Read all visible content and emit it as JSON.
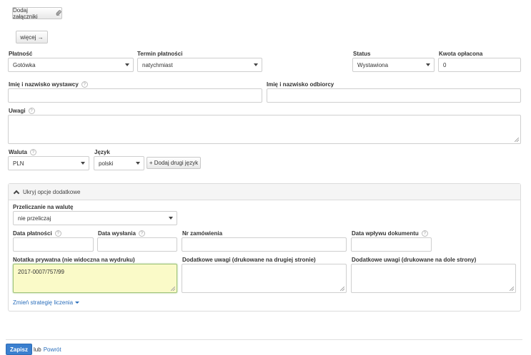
{
  "attachments": {
    "label": "Dodaj załączniki"
  },
  "more": {
    "label": "więcej →"
  },
  "payment": {
    "label": "Płatność",
    "value": "Gotówka",
    "term_label": "Termin płatności",
    "term_value": "natychmiast",
    "status_label": "Status",
    "status_value": "Wystawiona",
    "paid_label": "Kwota opłacona",
    "paid_value": "0"
  },
  "names": {
    "issuer_label": "Imię i nazwisko wystawcy",
    "recipient_label": "Imię i nazwisko odbiorcy"
  },
  "notes": {
    "label": "Uwagi"
  },
  "currency": {
    "label": "Waluta",
    "value": "PLN"
  },
  "language": {
    "label": "Język",
    "value": "polski",
    "add_second": "+ Dodaj drugi język"
  },
  "extra": {
    "toggle_label": "Ukryj opcje dodatkowe",
    "conversion_label": "Przeliczanie na walutę",
    "conversion_value": "nie przeliczaj",
    "payment_date_label": "Data płatności",
    "send_date_label": "Data wysłania",
    "order_no_label": "Nr zamówienia",
    "receipt_date_label": "Data wpływu dokumentu",
    "private_note_label": "Notatka prywatna (nie widoczna na wydruku)",
    "private_note_value": "2017-0007/757/99",
    "notes_second_page_label": "Dodatkowe uwagi (drukowane na drugiej stronie)",
    "notes_bottom_label": "Dodatkowe uwagi (drukowane na dole strony)",
    "strategy_label": "Zmień strategię liczenia"
  },
  "footer": {
    "save": "Zapisz",
    "or": "lub",
    "back": "Powrót"
  },
  "help_glyph": "?"
}
